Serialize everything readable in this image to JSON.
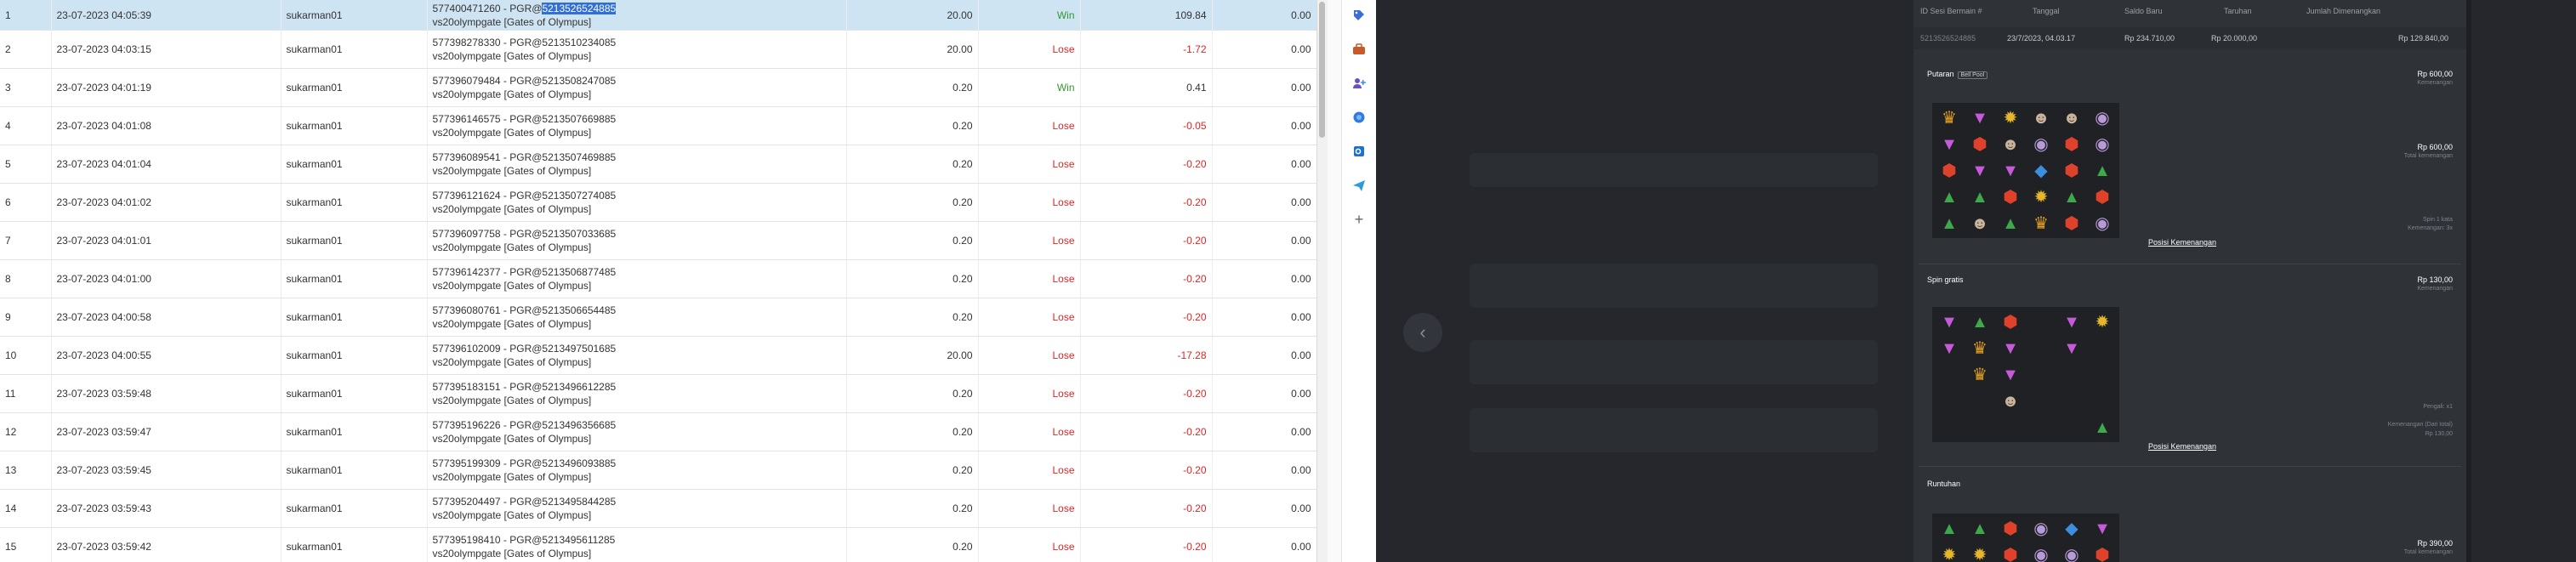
{
  "table": {
    "rows": [
      {
        "no": "1",
        "date": "23-07-2023 04:05:39",
        "user": "sukarman01",
        "desc1_pre": "577400471260 - PGR@",
        "desc1_hl": "5213526524885",
        "desc2": "vs20olympgate [Gates of Olympus]",
        "bet": "20.00",
        "result": "Win",
        "win": "109.84",
        "jp": "0.00",
        "selected": true
      },
      {
        "no": "2",
        "date": "23-07-2023 04:03:15",
        "user": "sukarman01",
        "desc1_pre": "577398278330 - PGR@5213510234085",
        "desc1_hl": "",
        "desc2": "vs20olympgate [Gates of Olympus]",
        "bet": "20.00",
        "result": "Lose",
        "win": "-1.72",
        "jp": "0.00"
      },
      {
        "no": "3",
        "date": "23-07-2023 04:01:19",
        "user": "sukarman01",
        "desc1_pre": "577396079484 - PGR@5213508247085",
        "desc1_hl": "",
        "desc2": "vs20olympgate [Gates of Olympus]",
        "bet": "0.20",
        "result": "Win",
        "win": "0.41",
        "jp": "0.00"
      },
      {
        "no": "4",
        "date": "23-07-2023 04:01:08",
        "user": "sukarman01",
        "desc1_pre": "577396146575 - PGR@5213507669885",
        "desc1_hl": "",
        "desc2": "vs20olympgate [Gates of Olympus]",
        "bet": "0.20",
        "result": "Lose",
        "win": "-0.05",
        "jp": "0.00"
      },
      {
        "no": "5",
        "date": "23-07-2023 04:01:04",
        "user": "sukarman01",
        "desc1_pre": "577396089541 - PGR@5213507469885",
        "desc1_hl": "",
        "desc2": "vs20olympgate [Gates of Olympus]",
        "bet": "0.20",
        "result": "Lose",
        "win": "-0.20",
        "jp": "0.00"
      },
      {
        "no": "6",
        "date": "23-07-2023 04:01:02",
        "user": "sukarman01",
        "desc1_pre": "577396121624 - PGR@5213507274085",
        "desc1_hl": "",
        "desc2": "vs20olympgate [Gates of Olympus]",
        "bet": "0.20",
        "result": "Lose",
        "win": "-0.20",
        "jp": "0.00"
      },
      {
        "no": "7",
        "date": "23-07-2023 04:01:01",
        "user": "sukarman01",
        "desc1_pre": "577396097758 - PGR@5213507033685",
        "desc1_hl": "",
        "desc2": "vs20olympgate [Gates of Olympus]",
        "bet": "0.20",
        "result": "Lose",
        "win": "-0.20",
        "jp": "0.00"
      },
      {
        "no": "8",
        "date": "23-07-2023 04:01:00",
        "user": "sukarman01",
        "desc1_pre": "577396142377 - PGR@5213506877485",
        "desc1_hl": "",
        "desc2": "vs20olympgate [Gates of Olympus]",
        "bet": "0.20",
        "result": "Lose",
        "win": "-0.20",
        "jp": "0.00"
      },
      {
        "no": "9",
        "date": "23-07-2023 04:00:58",
        "user": "sukarman01",
        "desc1_pre": "577396080761 - PGR@5213506654485",
        "desc1_hl": "",
        "desc2": "vs20olympgate [Gates of Olympus]",
        "bet": "0.20",
        "result": "Lose",
        "win": "-0.20",
        "jp": "0.00"
      },
      {
        "no": "10",
        "date": "23-07-2023 04:00:55",
        "user": "sukarman01",
        "desc1_pre": "577396102009 - PGR@5213497501685",
        "desc1_hl": "",
        "desc2": "vs20olympgate [Gates of Olympus]",
        "bet": "20.00",
        "result": "Lose",
        "win": "-17.28",
        "jp": "0.00"
      },
      {
        "no": "11",
        "date": "23-07-2023 03:59:48",
        "user": "sukarman01",
        "desc1_pre": "577395183151 - PGR@5213496612285",
        "desc1_hl": "",
        "desc2": "vs20olympgate [Gates of Olympus]",
        "bet": "0.20",
        "result": "Lose",
        "win": "-0.20",
        "jp": "0.00"
      },
      {
        "no": "12",
        "date": "23-07-2023 03:59:47",
        "user": "sukarman01",
        "desc1_pre": "577395196226 - PGR@5213496356685",
        "desc1_hl": "",
        "desc2": "vs20olympgate [Gates of Olympus]",
        "bet": "0.20",
        "result": "Lose",
        "win": "-0.20",
        "jp": "0.00"
      },
      {
        "no": "13",
        "date": "23-07-2023 03:59:45",
        "user": "sukarman01",
        "desc1_pre": "577395199309 - PGR@5213496093885",
        "desc1_hl": "",
        "desc2": "vs20olympgate [Gates of Olympus]",
        "bet": "0.20",
        "result": "Lose",
        "win": "-0.20",
        "jp": "0.00"
      },
      {
        "no": "14",
        "date": "23-07-2023 03:59:43",
        "user": "sukarman01",
        "desc1_pre": "577395204497 - PGR@5213495844285",
        "desc1_hl": "",
        "desc2": "vs20olympgate [Gates of Olympus]",
        "bet": "0.20",
        "result": "Lose",
        "win": "-0.20",
        "jp": "0.00"
      },
      {
        "no": "15",
        "date": "23-07-2023 03:59:42",
        "user": "sukarman01",
        "desc1_pre": "577395198410 - PGR@5213495611285",
        "desc1_hl": "",
        "desc2": "vs20olympgate [Gates of Olympus]",
        "bet": "0.20",
        "result": "Lose",
        "win": "-0.20",
        "jp": "0.00"
      }
    ]
  },
  "sidebar": {
    "icons": [
      "tag-icon",
      "toolbox-icon",
      "user-plus-icon",
      "shield-icon",
      "outlook-icon",
      "send-icon",
      "plus-icon"
    ]
  },
  "panel": {
    "headers": {
      "id": "ID Sesi Bermain #",
      "date": "Tanggal",
      "balance": "Saldo Baru",
      "bet": "Taruhan",
      "total_win": "Jumlah Dimenangkan"
    },
    "row": {
      "id": "5213526524885",
      "date": "23/7/2023, 04.03.17",
      "balance": "Rp 234.710,00",
      "bet": "Rp 20.000,00",
      "total_win": "Rp 129.840,00"
    },
    "section1": {
      "title": "Putaran",
      "badge": "Bell Pool",
      "amount": "Rp 600,00",
      "amount_label": "Kemenangan",
      "total": "Rp 600,00",
      "total_label": "Total kemenangan",
      "note1": "Spin 1 kata",
      "note2": "Kemenangan: 3x",
      "link": "Posisi Kemenangan"
    },
    "section2": {
      "title": "Spin gratis",
      "amount": "Rp 130,00",
      "amount_label": "Kemenangan",
      "note1": "Pengali: x1",
      "note2": "Kemenangan (Dari total)",
      "note3": "Rp 130,00",
      "link": "Posisi Kemenangan"
    },
    "section3": {
      "title": "Runtuhan",
      "amount": "Rp 390,00",
      "amount_label": "Total kemenangan"
    }
  },
  "colors": {
    "win": "#2e9a2e",
    "lose": "#e02424",
    "highlight": "#2f6fd6",
    "selected_row": "#cfe4f2",
    "dark_bg": "#25272c"
  }
}
